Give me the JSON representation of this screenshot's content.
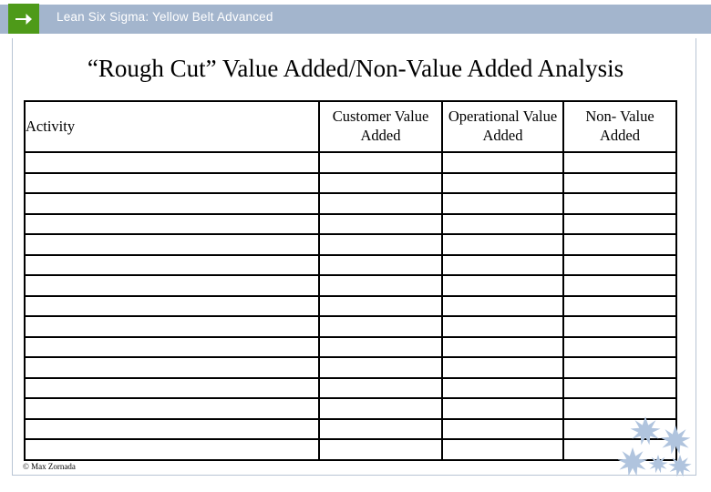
{
  "header": {
    "arrow_icon": "arrow-right-icon",
    "title": "Lean Six Sigma: Yellow Belt Advanced",
    "bar_color": "#a3b5cd",
    "arrow_box_color": "#4e9a19",
    "title_color": "#ffffff"
  },
  "slide": {
    "title": "“Rough Cut” Value Added/Non-Value Added Analysis",
    "background_color": "#ffffff",
    "border_color": "#b8c4d4"
  },
  "table": {
    "columns": [
      {
        "key": "activity",
        "label": "Activity",
        "align": "left"
      },
      {
        "key": "customer_value_added",
        "label": "Customer Value Added",
        "align": "center"
      },
      {
        "key": "operational_value_added",
        "label": "Operational Value Added",
        "align": "center"
      },
      {
        "key": "non_value_added",
        "label": "Non- Value Added",
        "align": "center"
      }
    ],
    "row_count": 15,
    "rows": [
      {
        "activity": "",
        "customer_value_added": "",
        "operational_value_added": "",
        "non_value_added": ""
      },
      {
        "activity": "",
        "customer_value_added": "",
        "operational_value_added": "",
        "non_value_added": ""
      },
      {
        "activity": "",
        "customer_value_added": "",
        "operational_value_added": "",
        "non_value_added": ""
      },
      {
        "activity": "",
        "customer_value_added": "",
        "operational_value_added": "",
        "non_value_added": ""
      },
      {
        "activity": "",
        "customer_value_added": "",
        "operational_value_added": "",
        "non_value_added": ""
      },
      {
        "activity": "",
        "customer_value_added": "",
        "operational_value_added": "",
        "non_value_added": ""
      },
      {
        "activity": "",
        "customer_value_added": "",
        "operational_value_added": "",
        "non_value_added": ""
      },
      {
        "activity": "",
        "customer_value_added": "",
        "operational_value_added": "",
        "non_value_added": ""
      },
      {
        "activity": "",
        "customer_value_added": "",
        "operational_value_added": "",
        "non_value_added": ""
      },
      {
        "activity": "",
        "customer_value_added": "",
        "operational_value_added": "",
        "non_value_added": ""
      },
      {
        "activity": "",
        "customer_value_added": "",
        "operational_value_added": "",
        "non_value_added": ""
      },
      {
        "activity": "",
        "customer_value_added": "",
        "operational_value_added": "",
        "non_value_added": ""
      },
      {
        "activity": "",
        "customer_value_added": "",
        "operational_value_added": "",
        "non_value_added": ""
      },
      {
        "activity": "",
        "customer_value_added": "",
        "operational_value_added": "",
        "non_value_added": ""
      },
      {
        "activity": "",
        "customer_value_added": "",
        "operational_value_added": "",
        "non_value_added": ""
      }
    ],
    "border_color": "#000000"
  },
  "footer": {
    "credit": "© Max Zornada"
  },
  "decoration": {
    "name": "southern-cross-stars",
    "star_color": "#b0c4de",
    "star_count": 5
  }
}
